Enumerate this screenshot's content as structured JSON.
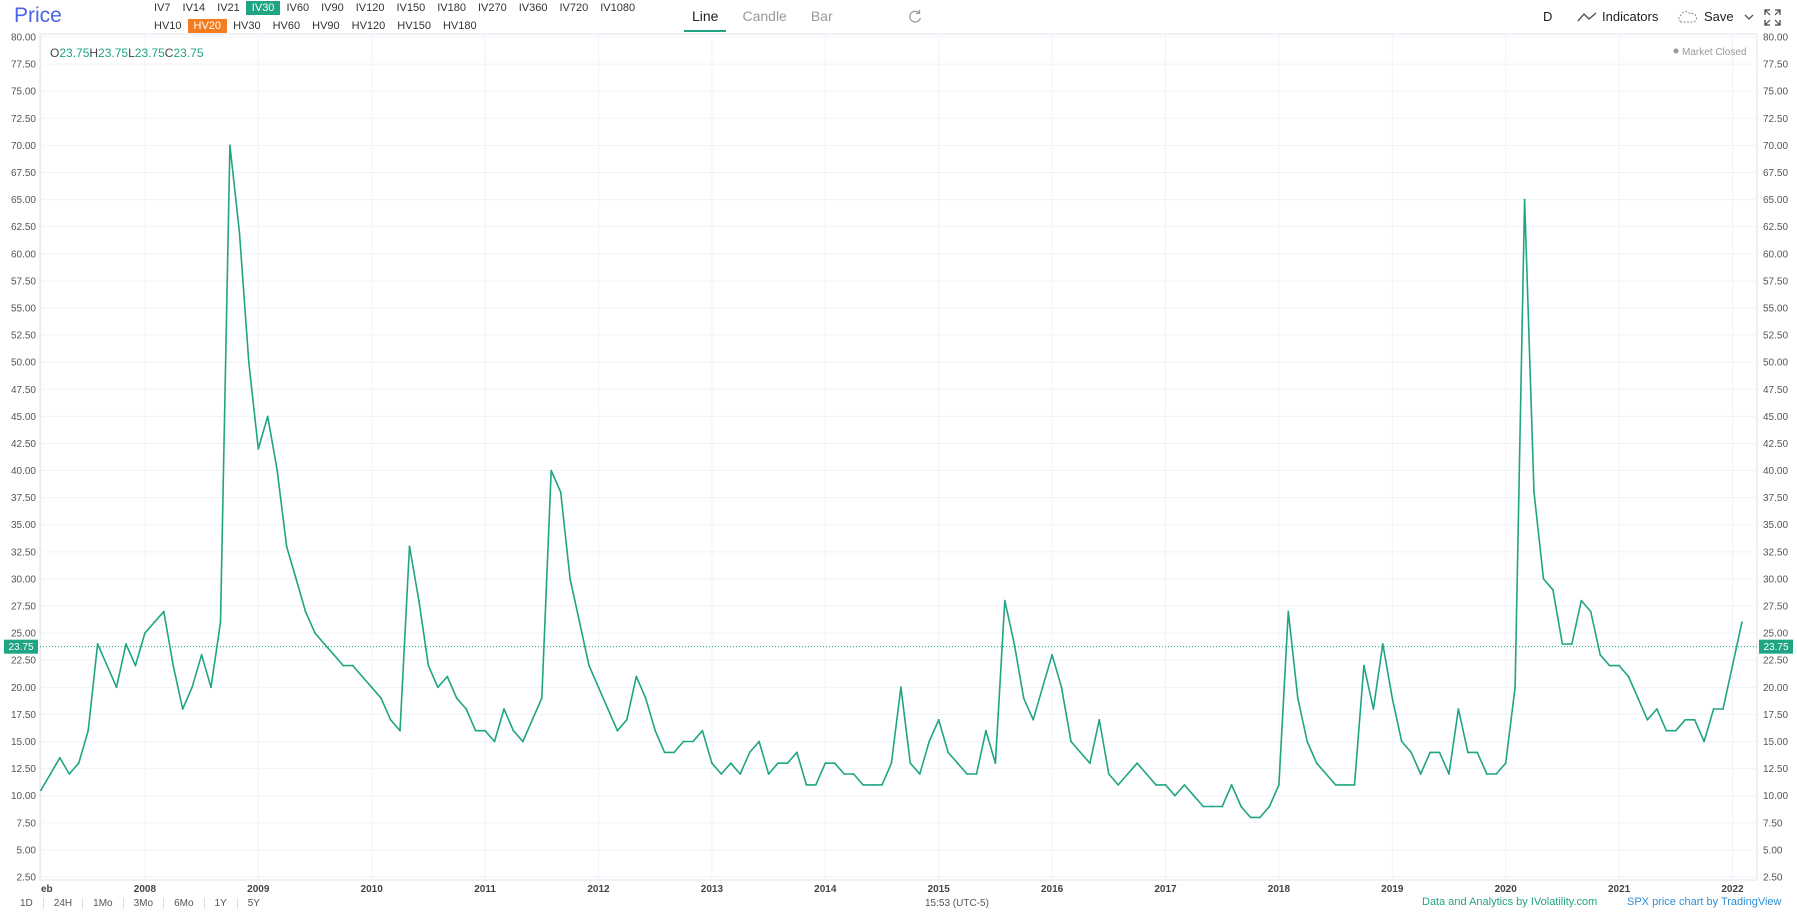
{
  "header": {
    "title": "Price",
    "iv_periods": [
      "IV7",
      "IV14",
      "IV21",
      "IV30",
      "IV60",
      "IV90",
      "IV120",
      "IV150",
      "IV180",
      "IV270",
      "IV360",
      "IV720",
      "IV1080"
    ],
    "iv_active": "IV30",
    "hv_periods": [
      "HV10",
      "HV20",
      "HV30",
      "HV60",
      "HV90",
      "HV120",
      "HV150",
      "HV180"
    ],
    "hv_active": "HV20",
    "chart_types": [
      "Line",
      "Candle",
      "Bar"
    ],
    "chart_type_active": "Line",
    "interval": "D",
    "indicators_label": "Indicators",
    "save_label": "Save"
  },
  "legend": {
    "o_label": "O",
    "o_value": "23.75",
    "h_label": "H",
    "h_value": "23.75",
    "l_label": "L",
    "l_value": "23.75",
    "c_label": "C",
    "c_value": "23.75"
  },
  "market_status": "Market Closed",
  "current_price_label": "23.75",
  "bottom": {
    "periods": [
      "1D",
      "24H",
      "1Mo",
      "3Mo",
      "6Mo",
      "1Y",
      "5Y"
    ],
    "clock": "15:53 (UTC-5)",
    "credit_left": "Data and Analytics by IVolatility.com",
    "credit_right": "SPX price chart by TradingView"
  },
  "colors": {
    "line": "#1fa583",
    "accent_iv": "#1fa583",
    "accent_hv": "#f47c20",
    "title": "#4d63e8"
  },
  "chart_data": {
    "type": "line",
    "series": [
      {
        "values_note": "",
        "x": [
          "2007-02",
          "2007-03",
          "2007-04",
          "2007-05",
          "2007-06",
          "2007-07",
          "2007-08",
          "2007-09",
          "2007-10",
          "2007-11",
          "2007-12",
          "2008-01",
          "2008-02",
          "2008-03",
          "2008-04",
          "2008-05",
          "2008-06",
          "2008-07",
          "2008-08",
          "2008-09",
          "2008-10",
          "2008-11",
          "2008-12",
          "2009-01",
          "2009-02",
          "2009-03",
          "2009-04",
          "2009-05",
          "2009-06",
          "2009-07",
          "2009-08",
          "2009-09",
          "2009-10",
          "2009-11",
          "2009-12",
          "2010-01",
          "2010-02",
          "2010-03",
          "2010-04",
          "2010-05",
          "2010-06",
          "2010-07",
          "2010-08",
          "2010-09",
          "2010-10",
          "2010-11",
          "2010-12",
          "2011-01",
          "2011-02",
          "2011-03",
          "2011-04",
          "2011-05",
          "2011-06",
          "2011-07",
          "2011-08",
          "2011-09",
          "2011-10",
          "2011-11",
          "2011-12",
          "2012-01",
          "2012-02",
          "2012-03",
          "2012-04",
          "2012-05",
          "2012-06",
          "2012-07",
          "2012-08",
          "2012-09",
          "2012-10",
          "2012-11",
          "2012-12",
          "2013-01",
          "2013-02",
          "2013-03",
          "2013-04",
          "2013-05",
          "2013-06",
          "2013-07",
          "2013-08",
          "2013-09",
          "2013-10",
          "2013-11",
          "2013-12",
          "2014-01",
          "2014-02",
          "2014-03",
          "2014-04",
          "2014-05",
          "2014-06",
          "2014-07",
          "2014-08",
          "2014-09",
          "2014-10",
          "2014-11",
          "2014-12",
          "2015-01",
          "2015-02",
          "2015-03",
          "2015-04",
          "2015-05",
          "2015-06",
          "2015-07",
          "2015-08",
          "2015-09",
          "2015-10",
          "2015-11",
          "2015-12",
          "2016-01",
          "2016-02",
          "2016-03",
          "2016-04",
          "2016-05",
          "2016-06",
          "2016-07",
          "2016-08",
          "2016-09",
          "2016-10",
          "2016-11",
          "2016-12",
          "2017-01",
          "2017-02",
          "2017-03",
          "2017-04",
          "2017-05",
          "2017-06",
          "2017-07",
          "2017-08",
          "2017-09",
          "2017-10",
          "2017-11",
          "2017-12",
          "2018-01",
          "2018-02",
          "2018-03",
          "2018-04",
          "2018-05",
          "2018-06",
          "2018-07",
          "2018-08",
          "2018-09",
          "2018-10",
          "2018-11",
          "2018-12",
          "2019-01",
          "2019-02",
          "2019-03",
          "2019-04",
          "2019-05",
          "2019-06",
          "2019-07",
          "2019-08",
          "2019-09",
          "2019-10",
          "2019-11",
          "2019-12",
          "2020-01",
          "2020-02",
          "2020-03",
          "2020-04",
          "2020-05",
          "2020-06",
          "2020-07",
          "2020-08",
          "2020-09",
          "2020-10",
          "2020-11",
          "2020-12",
          "2021-01",
          "2021-02",
          "2021-03",
          "2021-04",
          "2021-05",
          "2021-06",
          "2021-07",
          "2021-08",
          "2021-09",
          "2021-10",
          "2021-11",
          "2021-12",
          "2022-01",
          "2022-02"
        ],
        "values": [
          10.5,
          12,
          13.5,
          12,
          13,
          16,
          24,
          22,
          20,
          24,
          22,
          25,
          26,
          27,
          22,
          18,
          20,
          23,
          20,
          26,
          70,
          62,
          50,
          42,
          45,
          40,
          33,
          30,
          27,
          25,
          24,
          23,
          22,
          22,
          21,
          20,
          19,
          17,
          16,
          33,
          28,
          22,
          20,
          21,
          19,
          18,
          16,
          16,
          15,
          18,
          16,
          15,
          17,
          19,
          40,
          38,
          30,
          26,
          22,
          20,
          18,
          16,
          17,
          21,
          19,
          16,
          14,
          14,
          15,
          15,
          16,
          13,
          12,
          13,
          12,
          14,
          15,
          12,
          13,
          13,
          14,
          11,
          11,
          13,
          13,
          12,
          12,
          11,
          11,
          11,
          13,
          20,
          13,
          12,
          15,
          17,
          14,
          13,
          12,
          12,
          16,
          13,
          28,
          24,
          19,
          17,
          20,
          23,
          20,
          15,
          14,
          13,
          17,
          12,
          11,
          12,
          13,
          12,
          11,
          11,
          10,
          11,
          10,
          9,
          9,
          9,
          11,
          9,
          8,
          8,
          9,
          11,
          27,
          19,
          15,
          13,
          12,
          11,
          11,
          11,
          22,
          18,
          24,
          19,
          15,
          14,
          12,
          14,
          14,
          12,
          18,
          14,
          14,
          12,
          12,
          13,
          20,
          65,
          38,
          30,
          29,
          24,
          24,
          28,
          27,
          23,
          22,
          22,
          21,
          19,
          17,
          18,
          16,
          16,
          17,
          17,
          15,
          18,
          18,
          22,
          26
        ]
      }
    ],
    "xlabel": "",
    "ylabel": "",
    "ylim": [
      2.5,
      80
    ],
    "y_ticks": [
      "2.50",
      "5.00",
      "7.50",
      "10.00",
      "12.50",
      "15.00",
      "17.50",
      "20.00",
      "22.50",
      "25.00",
      "27.50",
      "30.00",
      "32.50",
      "35.00",
      "37.50",
      "40.00",
      "42.50",
      "45.00",
      "47.50",
      "50.00",
      "52.50",
      "55.00",
      "57.50",
      "60.00",
      "62.50",
      "65.00",
      "67.50",
      "70.00",
      "72.50",
      "75.00",
      "77.50",
      "80.00"
    ],
    "x_ticks": [
      "eb",
      "2008",
      "2009",
      "2010",
      "2011",
      "2012",
      "2013",
      "2014",
      "2015",
      "2016",
      "2017",
      "2018",
      "2019",
      "2020",
      "2021",
      "2022"
    ],
    "x_tick_dates": [
      "2007-02",
      "2008-01",
      "2009-01",
      "2010-01",
      "2011-01",
      "2012-01",
      "2013-01",
      "2014-01",
      "2015-01",
      "2016-01",
      "2017-01",
      "2018-01",
      "2019-01",
      "2020-01",
      "2021-01",
      "2022-01"
    ],
    "last_value": 23.75,
    "grid": true,
    "legend_position": "top-left"
  }
}
